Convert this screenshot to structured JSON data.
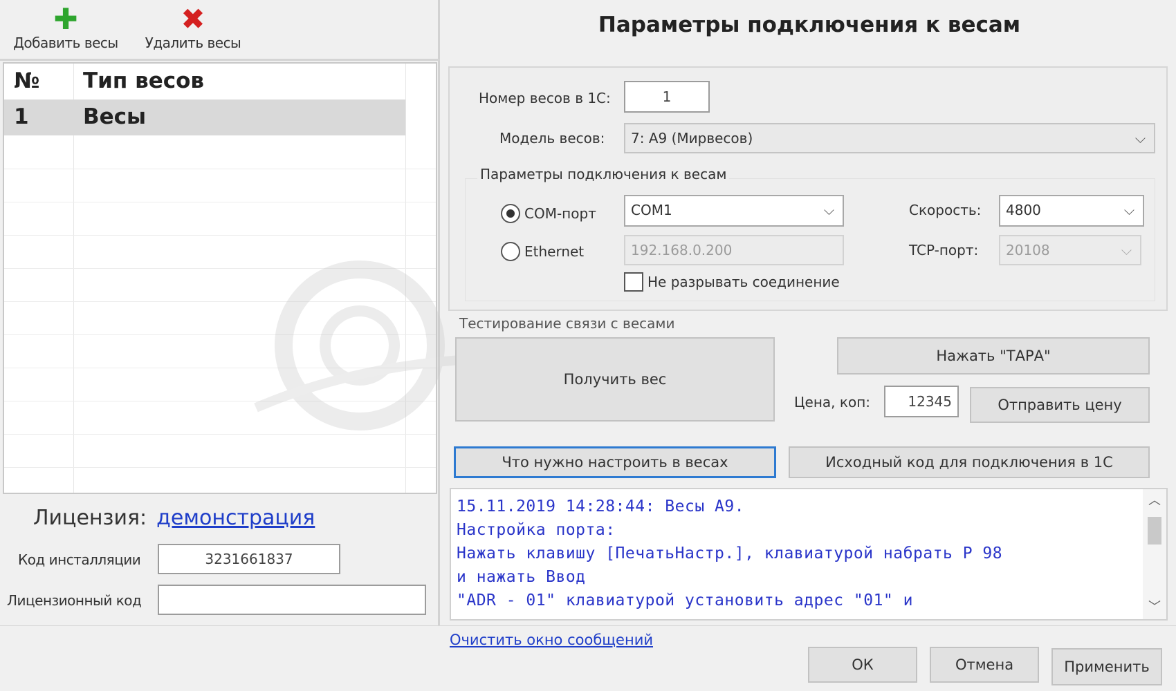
{
  "toolbar": {
    "add_label": "Добавить весы",
    "add_icon": "plus-icon",
    "delete_label": "Удалить весы",
    "delete_icon": "x-icon"
  },
  "scales_table": {
    "columns": [
      "№",
      "Тип весов"
    ],
    "rows": [
      {
        "no": "1",
        "type": "Весы"
      }
    ]
  },
  "license": {
    "label": "Лицензия:",
    "value_link": "демонстрация",
    "install_code_label": "Код инсталляции",
    "install_code_value": "3231661837",
    "license_code_label": "Лицензионный код",
    "license_code_value": ""
  },
  "main": {
    "title": "Параметры подключения к весам",
    "scale_number_label": "Номер весов в 1С:",
    "scale_number_value": "1",
    "model_label": "Модель весов:",
    "model_value": "7: А9 (Мирвесов)",
    "connection_group_label": "Параметры подключения к весам",
    "com_port_label": "COM-порт",
    "com_port_value": "COM1",
    "speed_label": "Скорость:",
    "speed_value": "4800",
    "ethernet_label": "Ethernet",
    "ethernet_value": "192.168.0.200",
    "tcp_port_label": "TCP-порт:",
    "tcp_port_value": "20108",
    "keep_connection_label": "Не разрывать соединение",
    "connection_type_selected": "COM-порт",
    "keep_connection_checked": false
  },
  "testing": {
    "group_label": "Тестирование связи с весами",
    "get_weight_button": "Получить вес",
    "tare_button": "Нажать \"ТАРА\"",
    "price_label": "Цена, коп:",
    "price_value": "12345",
    "send_price_button": "Отправить цену"
  },
  "actions": {
    "setup_button": "Что нужно настроить в весах",
    "source_code_button": "Исходный код для подключения в 1С"
  },
  "log": {
    "lines": [
      "15.11.2019 14:28:44: Весы А9.",
      " Настройка порта:",
      " Нажать клавишу [ПечатьНастр.], клавиатурой набрать Р 98",
      "и нажать Ввод",
      " \"ADR - 01\" клавиатурой установить адрес \"01\" и"
    ]
  },
  "footer": {
    "clear_link": "Очистить окно сообщений",
    "ok_button": "ОК",
    "cancel_button": "Отмена",
    "apply_button": "Применить"
  },
  "colors": {
    "link": "#1f3ec9",
    "log_text": "#2a35c9",
    "add_icon": "#2ea52e",
    "delete_icon": "#d42020",
    "focus_border": "#2e7ad1"
  }
}
